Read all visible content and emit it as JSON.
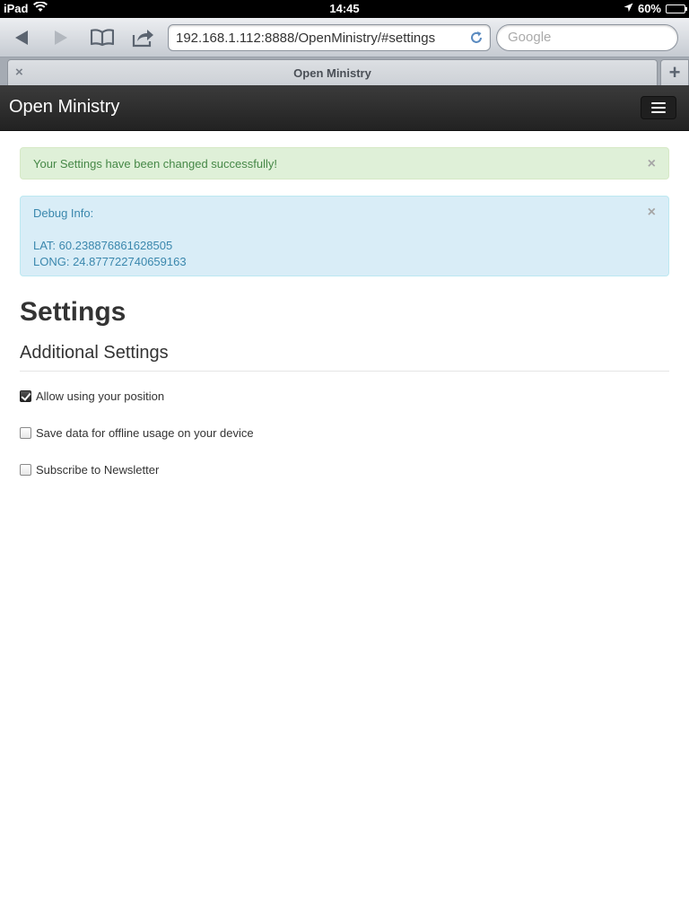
{
  "status_bar": {
    "device": "iPad",
    "time": "14:45",
    "battery": "60%",
    "battery_level": 0.6
  },
  "toolbar": {
    "url": "192.168.1.112:8888/OpenMinistry/#settings",
    "search_placeholder": "Google"
  },
  "tabs": {
    "active_title": "Open Ministry",
    "new_tab_label": "+"
  },
  "navbar": {
    "brand": "Open Ministry"
  },
  "alerts": {
    "success": {
      "message": "Your Settings have been changed successfully!"
    },
    "debug": {
      "title": "Debug Info:",
      "lat": "LAT: 60.238876861628505",
      "long": "LONG: 24.877722740659163"
    }
  },
  "page": {
    "title": "Settings",
    "section_title": "Additional Settings",
    "options": [
      {
        "label": "Allow using your position",
        "checked": true
      },
      {
        "label": "Save data for offline usage on your device",
        "checked": false
      },
      {
        "label": "Subscribe to Newsletter",
        "checked": false
      }
    ]
  },
  "colors": {
    "success_bg": "#dff0d8",
    "success_text": "#468847",
    "info_bg": "#d9edf7",
    "info_text": "#3a87ad",
    "navbar_bg": "#2b2b2b"
  },
  "icons": {
    "close": "×"
  }
}
